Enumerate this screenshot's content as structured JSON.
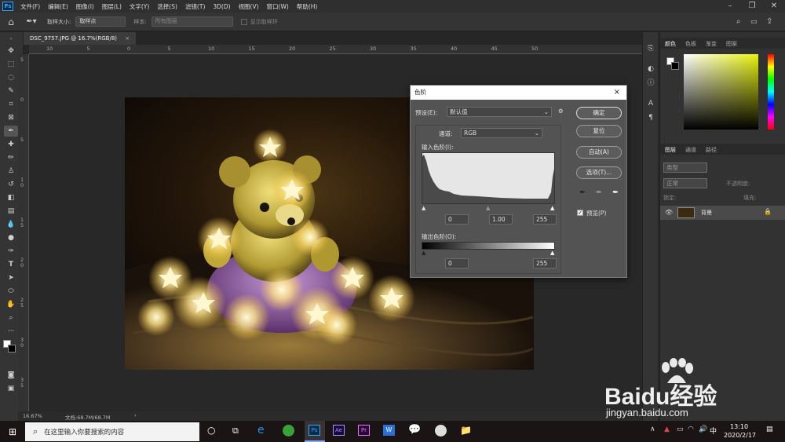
{
  "app": {
    "logo": "Ps"
  },
  "menu": [
    "文件(F)",
    "编辑(E)",
    "图像(I)",
    "图层(L)",
    "文字(Y)",
    "选择(S)",
    "滤镜(T)",
    "3D(D)",
    "视图(V)",
    "窗口(W)",
    "帮助(H)"
  ],
  "options": {
    "sample_size_label": "取样大小:",
    "sample_size_value": "取样点",
    "sample_label": "样本:",
    "sample_value": "所有图层",
    "show_ring_label": "显示取样环"
  },
  "document": {
    "tab_title": "DSC_9757.JPG @ 16.7%(RGB/8)",
    "close": "×"
  },
  "ruler_top": [
    "10",
    "5",
    "0",
    "5",
    "10",
    "15",
    "20",
    "25",
    "30",
    "35",
    "40",
    "45",
    "50"
  ],
  "ruler_left": [
    "5",
    "0",
    "5",
    "1\n0",
    "1\n5",
    "2\n0",
    "2\n5",
    "3\n0",
    "3\n5"
  ],
  "status": {
    "zoom": "16.67%",
    "doc": "文档:68.7M/68.7M",
    "arrow": "›"
  },
  "dialog": {
    "title": "色阶",
    "close": "×",
    "preset_label": "预设(E):",
    "preset_value": "默认值",
    "channel_label": "通道:",
    "channel_value": "RGB",
    "input_label": "输入色阶(I):",
    "input_values": [
      "0",
      "1.00",
      "255"
    ],
    "output_label": "输出色阶(O):",
    "output_values": [
      "0",
      "255"
    ],
    "buttons": {
      "ok": "确定",
      "reset": "复位",
      "auto": "自动(A)",
      "options": "选项(T)..."
    },
    "preview_label": "预览(P)"
  },
  "right_panel": {
    "top_tabs": [
      "颜色",
      "色板",
      "渐变",
      "图案"
    ],
    "layer_tabs": [
      "图层",
      "通道",
      "路径"
    ],
    "filter_label": "类型",
    "blend_mode": "正常",
    "opacity_label": "不透明度:",
    "lock_label": "锁定:",
    "fill_label": "填充:",
    "layer_name": "背景"
  },
  "taskbar": {
    "search_placeholder": "在这里输入你要搜索的内容",
    "time": "13:10",
    "date": "2020/2/17",
    "ime": "中",
    "app_labels": [
      "Ps",
      "Ae",
      "Pr",
      "W"
    ]
  },
  "watermark": {
    "brand": "Baidu经验",
    "url": "jingyan.baidu.com"
  },
  "colors": {
    "accent": "#31a8ff",
    "dialog_bg": "#535353",
    "panel_bg": "#323232",
    "taskbar": "#1a1414"
  }
}
